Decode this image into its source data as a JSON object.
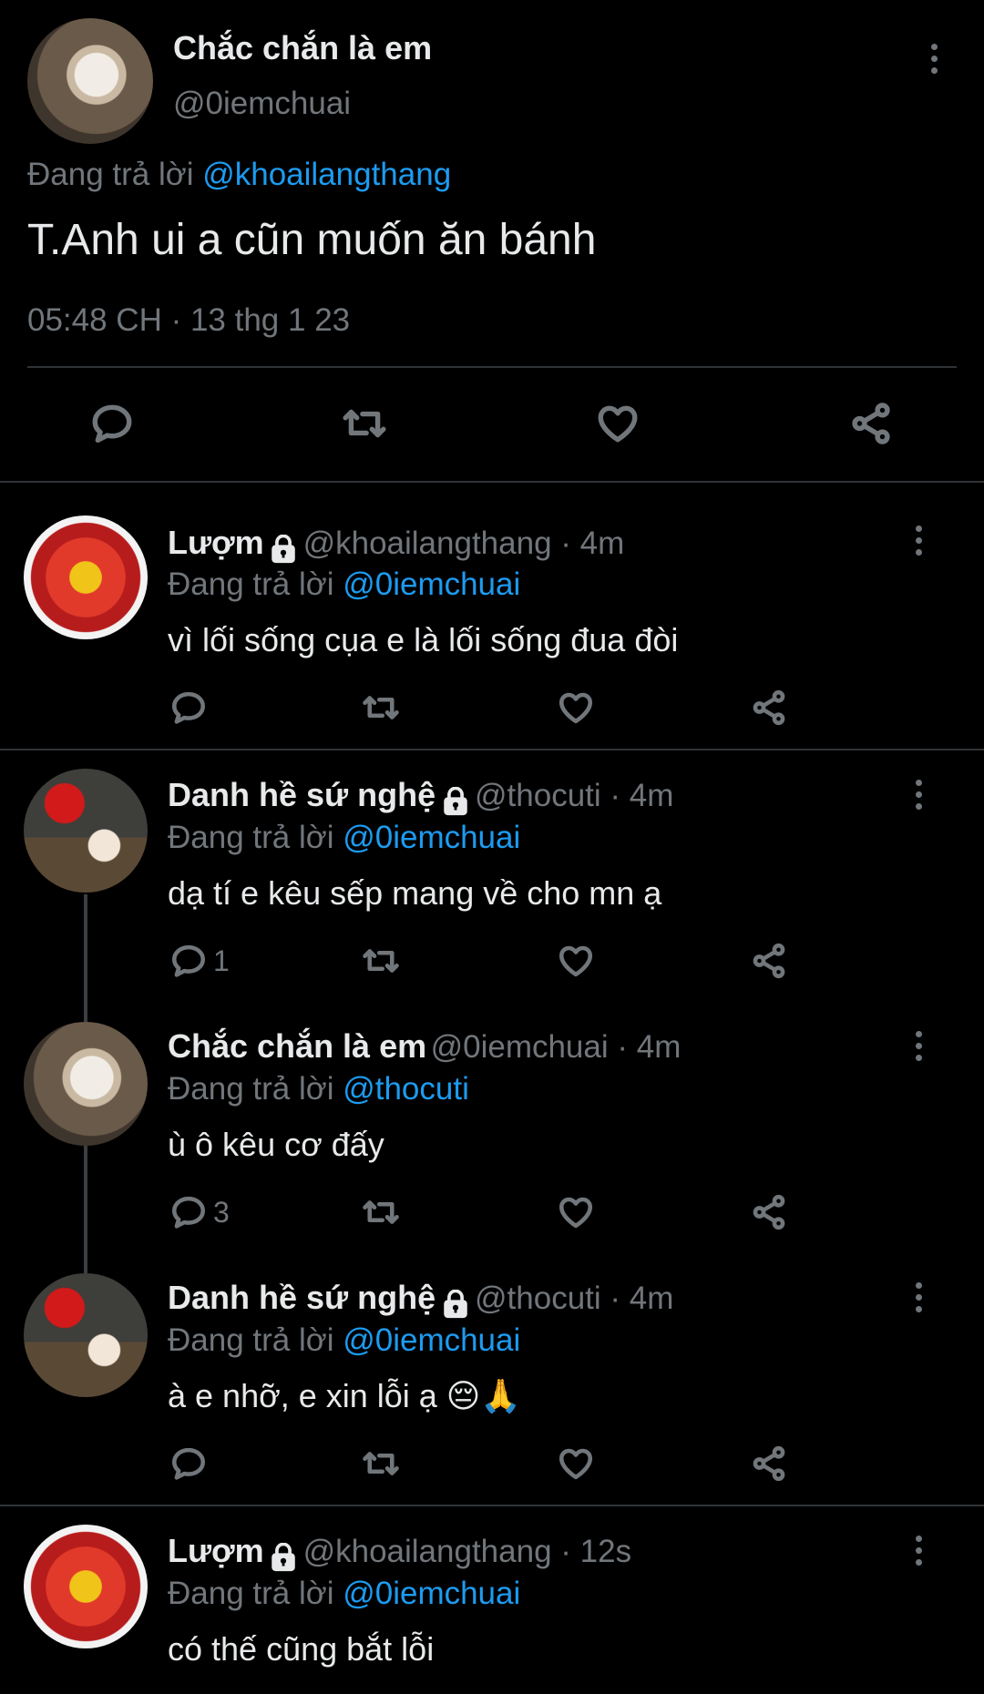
{
  "main_tweet": {
    "name": "Chắc chắn là em",
    "handle": "@0iemchuai",
    "replying_prefix": "Đang trả lời ",
    "replying_to": "@khoailangthang",
    "text": "T.Anh ui a cũn muốn ăn bánh",
    "timestamp": "05:48 CH · 13 thg 1 23"
  },
  "replies": [
    {
      "name": "Lượm",
      "locked": true,
      "handle": "@khoailangthang",
      "time": " · 4m",
      "replying_prefix": "Đang trả lời ",
      "replying_to": "@0iemchuai",
      "text": "vì lối sống cụa e là lối sống đua đòi",
      "reply_count": ""
    },
    {
      "name": "Danh hề sứ nghệ",
      "locked": true,
      "handle": "@thocuti",
      "time": " · 4m",
      "replying_prefix": "Đang trả lời ",
      "replying_to": "@0iemchuai",
      "text": "dạ tí e kêu sếp mang về cho mn ạ",
      "reply_count": "1"
    },
    {
      "name": "Chắc chắn là em",
      "locked": false,
      "handle": "@0iemchuai",
      "time": " · 4m",
      "replying_prefix": "Đang trả lời ",
      "replying_to": "@thocuti",
      "text": "ù ô kêu cơ đấy",
      "reply_count": "3"
    },
    {
      "name": "Danh hề sứ nghệ",
      "locked": true,
      "handle": "@thocuti",
      "time": " · 4m",
      "replying_prefix": "Đang trả lời ",
      "replying_to": "@0iemchuai",
      "text": "à e nhỡ, e xin lỗi ạ 😔🙏",
      "reply_count": ""
    },
    {
      "name": "Lượm",
      "locked": true,
      "handle": "@khoailangthang",
      "time": " · 12s",
      "replying_prefix": "Đang trả lời ",
      "replying_to": "@0iemchuai",
      "text": "có thế cũng bắt lỗi",
      "reply_count": ""
    }
  ],
  "colors": {
    "background": "#000000",
    "text": "#e7e9ea",
    "muted": "#71767b",
    "link": "#1d9bf0",
    "divider": "#2f3336"
  },
  "icons": {
    "reply": "reply-icon",
    "retweet": "retweet-icon",
    "like": "heart-icon",
    "share": "share-icon",
    "more": "more-vertical-icon",
    "lock": "lock-icon"
  }
}
